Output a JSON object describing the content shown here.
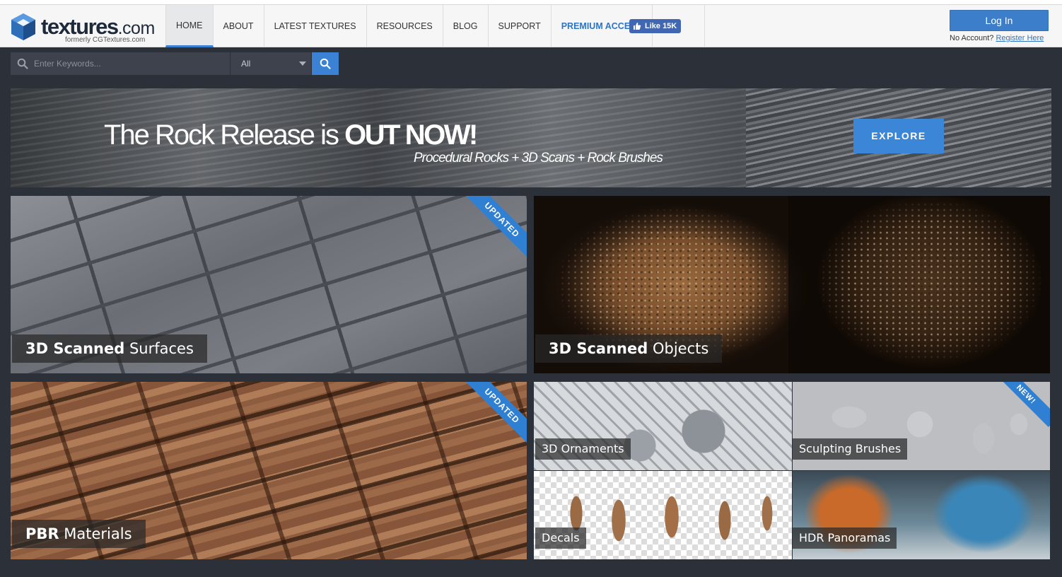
{
  "brand": {
    "name": "textures",
    "tld": ".com",
    "tagline": "formerly CGTextures.com"
  },
  "nav": {
    "items": [
      {
        "label": "HOME",
        "active": true
      },
      {
        "label": "ABOUT"
      },
      {
        "label": "LATEST TEXTURES"
      },
      {
        "label": "RESOURCES"
      },
      {
        "label": "BLOG"
      },
      {
        "label": "SUPPORT"
      },
      {
        "label": "PREMIUM ACCESS",
        "highlight": true
      }
    ],
    "facebook_like": "Like 15K"
  },
  "account": {
    "login_label": "Log In",
    "no_account_text": "No Account?",
    "register_link": "Register Here"
  },
  "search": {
    "placeholder": "Enter Keywords...",
    "category": "All"
  },
  "banner": {
    "headline_light": "The Rock Release is ",
    "headline_bold": "OUT NOW!",
    "subline": "Procedural Rocks + 3D Scans + Rock Brushes",
    "cta_label": "EXPLORE"
  },
  "tiles": {
    "surfaces": {
      "bold": "3D Scanned",
      "light": " Surfaces",
      "ribbon": "UPDATED"
    },
    "objects": {
      "bold": "3D Scanned",
      "light": " Objects"
    },
    "pbr": {
      "bold": "PBR",
      "light": " Materials",
      "ribbon": "UPDATED"
    },
    "ornaments": {
      "label": "3D Ornaments"
    },
    "brushes": {
      "label": "Sculpting Brushes",
      "ribbon": "NEW!"
    },
    "decals": {
      "label": "Decals"
    },
    "hdr": {
      "label": "HDR Panoramas"
    }
  },
  "colors": {
    "accent": "#3b82d4",
    "page_bg": "#2c3039",
    "header_bg": "#f6f6f6"
  }
}
